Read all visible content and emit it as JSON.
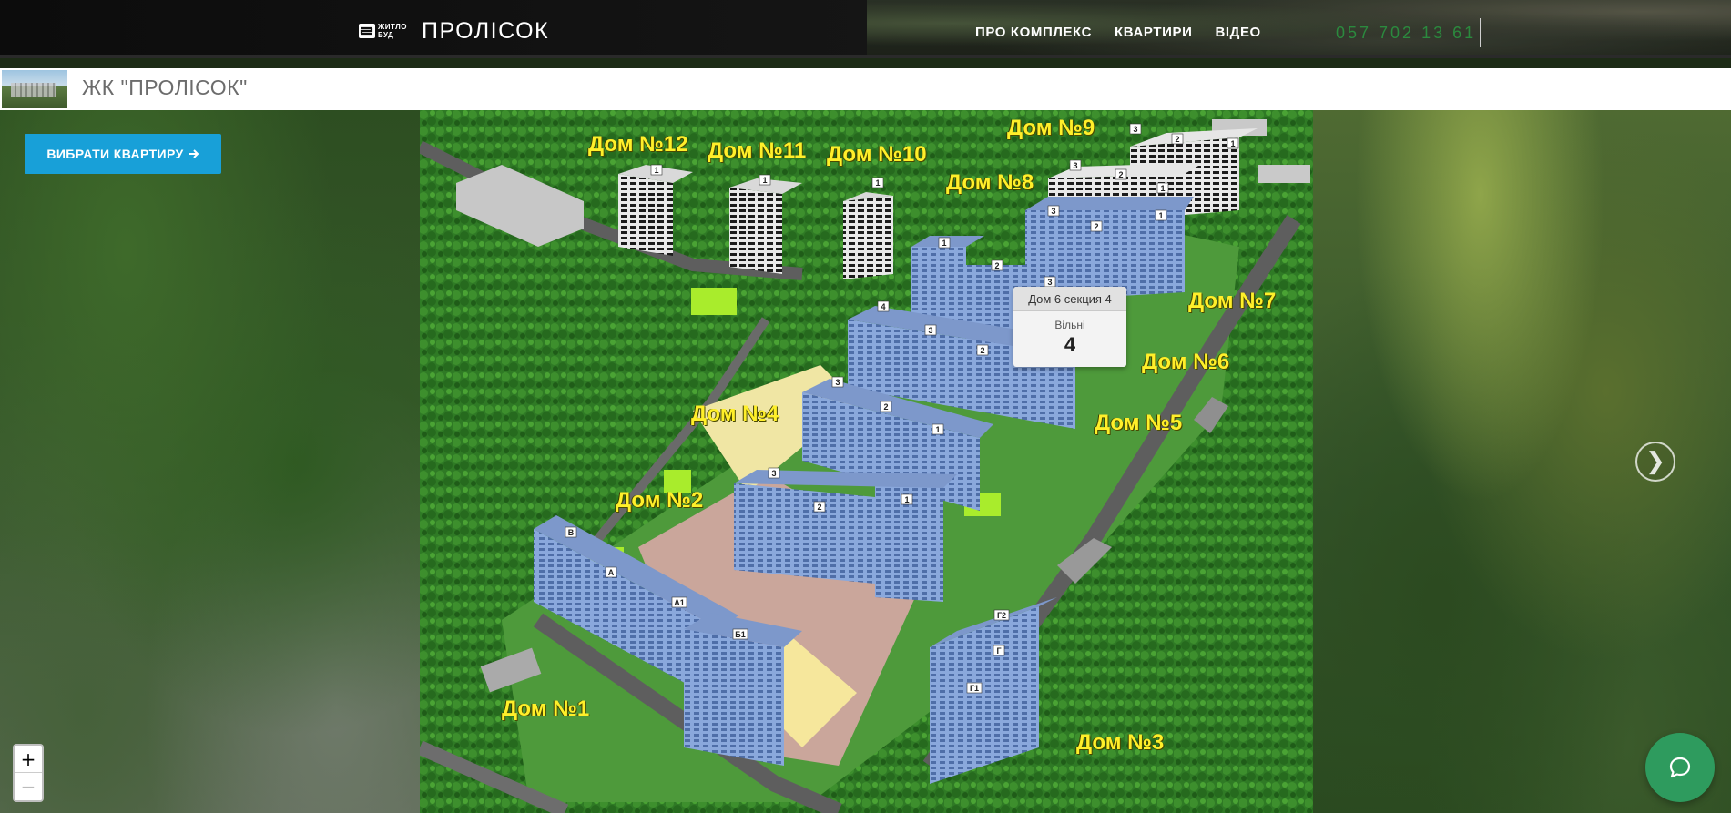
{
  "header": {
    "logo_small": "ЖИТЛО\nБУД",
    "logo_name": "ПРОЛІСОК",
    "nav": [
      "ПРО КОМПЛЕКС",
      "КВАРТИРИ",
      "ВІДЕО"
    ],
    "phone": "057 702 13 61"
  },
  "page": {
    "title": "ЖК \"ПРОЛІСОК\""
  },
  "actions": {
    "choose_label": "ВИБРАТИ КВАРТИРУ",
    "choose_icon": "arrow-right-icon"
  },
  "map": {
    "buildings": [
      "Дом №1",
      "Дом №2",
      "Дом №3",
      "Дом №4",
      "Дом №5",
      "Дом №6",
      "Дом №7",
      "Дом №8",
      "Дом №9",
      "Дом №10",
      "Дом №11",
      "Дом №12"
    ],
    "section_markers": [
      "1",
      "2",
      "3",
      "4",
      "В",
      "А",
      "А1",
      "Б1",
      "Г",
      "Г1",
      "Г2"
    ]
  },
  "tooltip": {
    "title": "Дом 6 секция 4",
    "label": "Вільні",
    "value": "4"
  },
  "controls": {
    "zoom_in": "+",
    "zoom_out": "−",
    "next": "❯"
  },
  "colors": {
    "accent_button": "#18a0d8",
    "label_yellow": "#ffef2a",
    "phone_green": "#2b8a3e",
    "chat_green": "#2e9b5e",
    "building_blue": "#7f9fd6"
  }
}
